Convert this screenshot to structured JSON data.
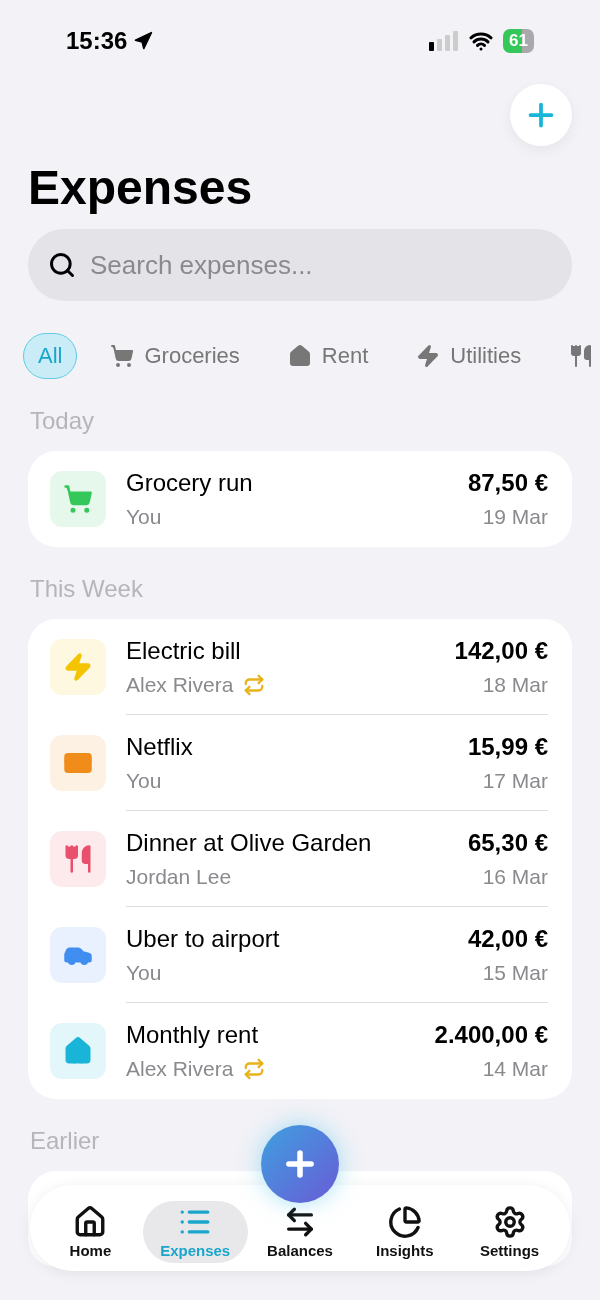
{
  "status_bar": {
    "time": "15:36",
    "battery": "61"
  },
  "title": "Expenses",
  "search": {
    "placeholder": "Search expenses..."
  },
  "filters": [
    {
      "label": "All",
      "kind": "none",
      "selected": true
    },
    {
      "label": "Groceries",
      "kind": "cart",
      "selected": false
    },
    {
      "label": "Rent",
      "kind": "house",
      "selected": false
    },
    {
      "label": "Utilities",
      "kind": "bolt",
      "selected": false
    },
    {
      "kind": "fork",
      "selected": false
    }
  ],
  "sections": [
    {
      "heading": "Today",
      "rows": [
        {
          "title": "Grocery run",
          "payer": "You",
          "amount": "87,50 €",
          "date": "19 Mar",
          "kind": "cart",
          "color": "#34c759",
          "recurring": false
        }
      ]
    },
    {
      "heading": "This Week",
      "rows": [
        {
          "title": "Electric bill",
          "payer": "Alex Rivera",
          "amount": "142,00 €",
          "date": "18 Mar",
          "kind": "bolt",
          "color": "#f5c400",
          "recurring": true
        },
        {
          "title": "Netflix",
          "payer": "You",
          "amount": "15,99 €",
          "date": "17 Mar",
          "kind": "card",
          "color": "#f08c1a",
          "recurring": false
        },
        {
          "title": "Dinner at Olive Garden",
          "payer": "Jordan Lee",
          "amount": "65,30 €",
          "date": "16 Mar",
          "kind": "fork",
          "color": "#e8506e",
          "recurring": false
        },
        {
          "title": "Uber to airport",
          "payer": "You",
          "amount": "42,00 €",
          "date": "15 Mar",
          "kind": "car",
          "color": "#3f8ef0",
          "recurring": false
        },
        {
          "title": "Monthly rent",
          "payer": "Alex Rivera",
          "amount": "2.400,00 €",
          "date": "14 Mar",
          "kind": "house",
          "color": "#19b5d8",
          "recurring": true
        }
      ]
    },
    {
      "heading": "Earlier"
    }
  ],
  "tabs": [
    {
      "label": "Home",
      "kind": "home",
      "selected": false
    },
    {
      "label": "Expenses",
      "kind": "list",
      "selected": true
    },
    {
      "label": "Balances",
      "kind": "arrows",
      "selected": false
    },
    {
      "label": "Insights",
      "kind": "pie",
      "selected": false
    },
    {
      "label": "Settings",
      "kind": "gear",
      "selected": false
    }
  ]
}
